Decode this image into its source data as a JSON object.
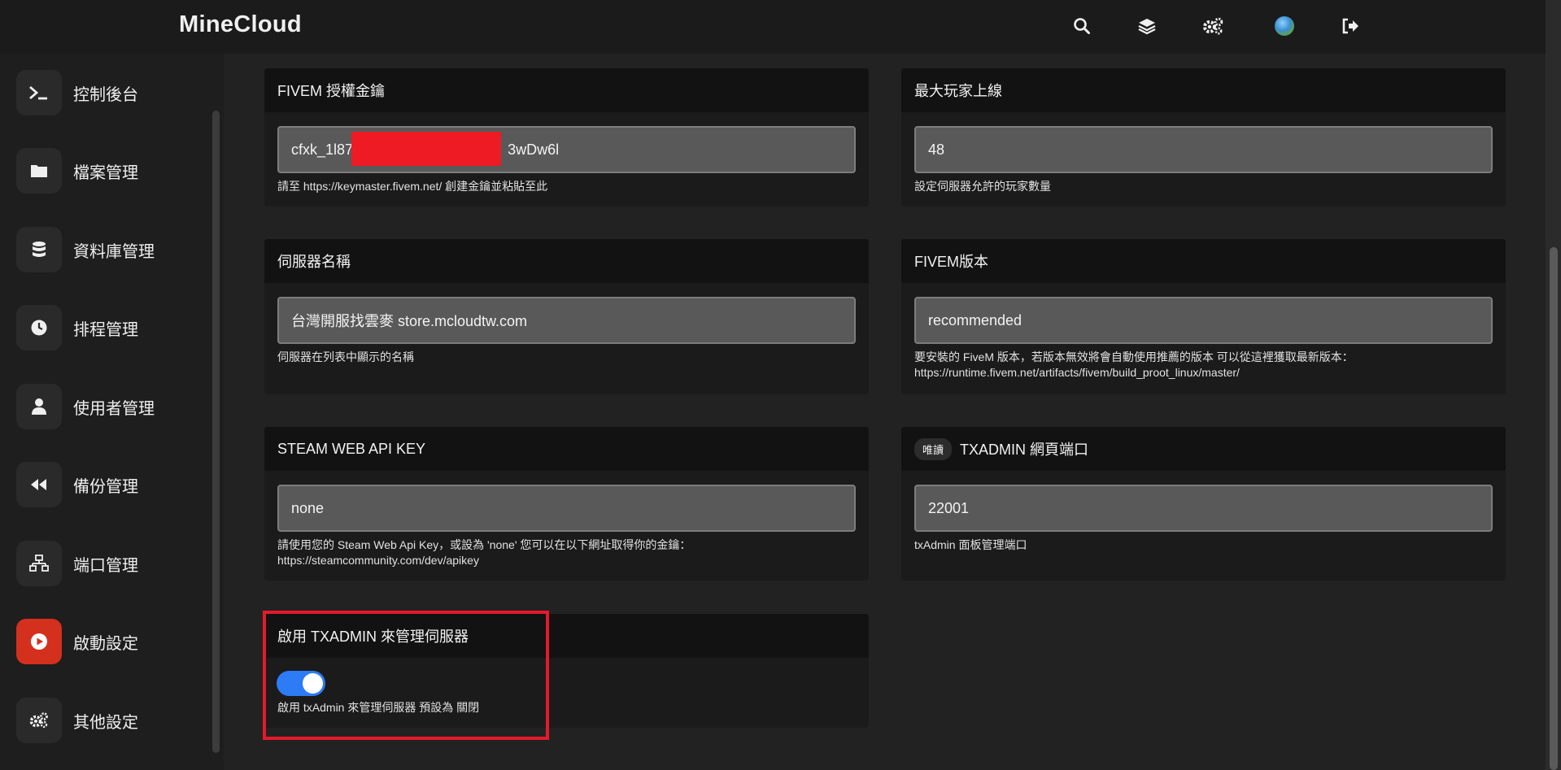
{
  "app": {
    "title": "MineCloud"
  },
  "topbar_icons": [
    "search-icon",
    "layers-icon",
    "gears-icon",
    "avatar",
    "logout-icon"
  ],
  "sidebar": {
    "items": [
      {
        "label": "控制後台",
        "icon": "terminal-icon"
      },
      {
        "label": "檔案管理",
        "icon": "folder-icon"
      },
      {
        "label": "資料庫管理",
        "icon": "database-icon"
      },
      {
        "label": "排程管理",
        "icon": "clock-icon"
      },
      {
        "label": "使用者管理",
        "icon": "user-icon"
      },
      {
        "label": "備份管理",
        "icon": "rewind-icon"
      },
      {
        "label": "端口管理",
        "icon": "network-icon"
      },
      {
        "label": "啟動設定",
        "icon": "play-icon",
        "active": true
      },
      {
        "label": "其他設定",
        "icon": "gears-icon"
      }
    ]
  },
  "cards": {
    "license_key": {
      "title": "FIVEM 授權金鑰",
      "value": "cfxk_1l87                                      3wDw6l",
      "hint": "請至 https://keymaster.fivem.net/ 創建金鑰並粘貼至此"
    },
    "max_players": {
      "title": "最大玩家上線",
      "value": "48",
      "hint": "設定伺服器允許的玩家數量"
    },
    "server_name": {
      "title": "伺服器名稱",
      "value": "台灣開服找雲麥 store.mcloudtw.com",
      "hint": "伺服器在列表中顯示的名稱"
    },
    "fivem_version": {
      "title": "FIVEM版本",
      "value": "recommended",
      "hint_line1": "要安裝的 FiveM 版本，若版本無效將會自動使用推薦的版本 可以從這裡獲取最新版本：",
      "hint_line2": "https://runtime.fivem.net/artifacts/fivem/build_proot_linux/master/"
    },
    "steam_api_key": {
      "title": "STEAM WEB API KEY",
      "value": "none",
      "hint_line1": "請使用您的 Steam Web Api Key，或設為 'none' 您可以在以下網址取得你的金鑰：",
      "hint_line2": "https://steamcommunity.com/dev/apikey"
    },
    "txadmin_port": {
      "badge": "唯讀",
      "title": "TXADMIN 網頁端口",
      "value": "22001",
      "hint": "txAdmin 面板管理端口"
    },
    "txadmin_enable": {
      "title": "啟用 TXADMIN 來管理伺服器",
      "enabled": true,
      "hint": "啟用 txAdmin 來管理伺服器 預設為 關閉"
    }
  },
  "colors": {
    "accent_active": "#d4301e",
    "toggle_on": "#2e7bf6",
    "highlight": "#e41a2a",
    "redaction": "#ee1b24"
  }
}
